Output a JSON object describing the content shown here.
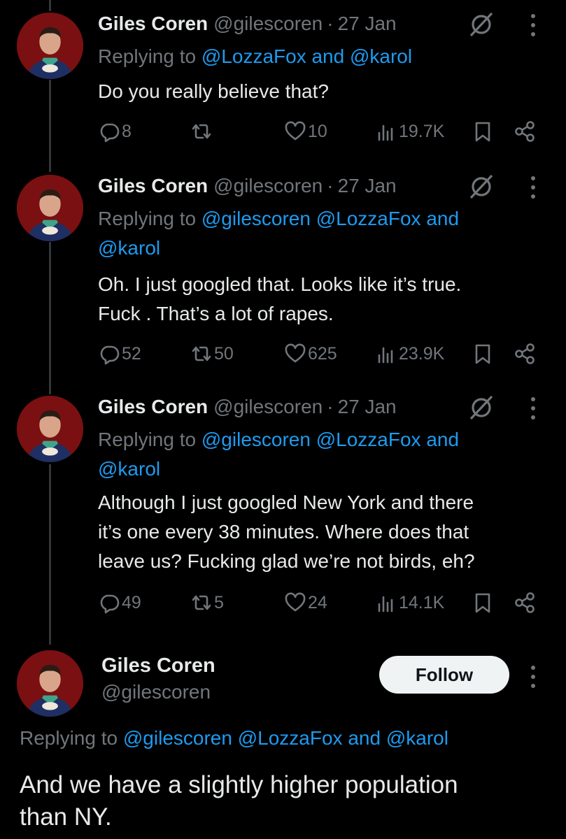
{
  "tweets": [
    {
      "name": "Giles Coren",
      "handle": "@gilescoren",
      "dot": "·",
      "date": "27 Jan",
      "replying_prefix": "Replying to",
      "replying_line1": [
        " ",
        "@LozzaFox",
        " and ",
        "@karol"
      ],
      "replying_line2": "",
      "text_lines": [
        "Do you really believe that?"
      ],
      "replies": "8",
      "retweets": "",
      "likes": "10",
      "views": "19.7K"
    },
    {
      "name": "Giles Coren",
      "handle": "@gilescoren",
      "dot": "·",
      "date": "27 Jan",
      "replying_prefix": "Replying to",
      "replying_line1": [
        " ",
        "@gilescoren",
        " ",
        "@LozzaFox",
        " ",
        "and"
      ],
      "replying_line2": "@karol",
      "text_lines": [
        "Oh. I just googled that. Looks like it’s true.",
        "Fuck . That’s a lot of rapes."
      ],
      "replies": "52",
      "retweets": "50",
      "likes": "625",
      "views": "23.9K"
    },
    {
      "name": "Giles Coren",
      "handle": "@gilescoren",
      "dot": "·",
      "date": "27 Jan",
      "replying_prefix": "Replying to",
      "replying_line1": [
        " ",
        "@gilescoren",
        " ",
        "@LozzaFox",
        " ",
        "and"
      ],
      "replying_line2": "@karol",
      "text_lines": [
        "Although I just googled New York and there",
        "it’s one every 38 minutes. Where does that",
        "leave us? Fucking glad we’re not birds, eh?"
      ],
      "replies": "49",
      "retweets": "5",
      "likes": "24",
      "views": "14.1K"
    }
  ],
  "main_tweet": {
    "name": "Giles Coren",
    "handle": "@gilescoren",
    "follow_label": "Follow",
    "replying_prefix": "Replying to",
    "mention1": "@gilescoren",
    "mention2": "@LozzaFox",
    "and_word": "and",
    "mention3": "@karol",
    "text_line1": "And we have a slightly higher population",
    "text_line2": "than NY."
  },
  "icons": {
    "reply": "reply-icon",
    "retweet": "retweet-icon",
    "like": "heart-icon",
    "views": "views-icon",
    "bookmark": "bookmark-icon",
    "share": "share-icon",
    "grok": "grok-icon",
    "more": "more-icon"
  },
  "colors": {
    "background": "#000000",
    "text": "#e7e9ea",
    "muted": "#71767b",
    "link": "#1d9bf0",
    "follow_bg": "#eff3f4"
  }
}
